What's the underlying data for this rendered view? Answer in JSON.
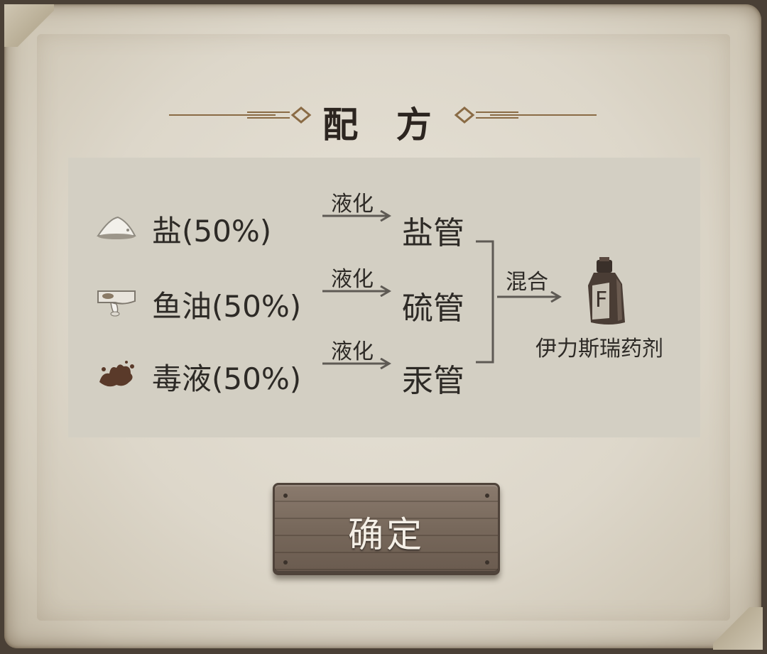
{
  "title": "配 方",
  "ingredients": [
    {
      "name": "盐(50%)",
      "icon": "salt-pile-icon",
      "process": "液化",
      "product": "盐管"
    },
    {
      "name": "鱼油(50%)",
      "icon": "fish-oil-icon",
      "process": "液化",
      "product": "硫管"
    },
    {
      "name": "毒液(50%)",
      "icon": "venom-splat-icon",
      "process": "液化",
      "product": "汞管"
    }
  ],
  "mix": {
    "label": "混合",
    "result": "伊力斯瑞药剂",
    "result_icon": "potion-bottle-icon"
  },
  "confirm_button": "确定",
  "colors": {
    "panel": "#d3cfc3",
    "text": "#2d2a26",
    "ornament": "#8a6b45",
    "button": "#77685b"
  }
}
